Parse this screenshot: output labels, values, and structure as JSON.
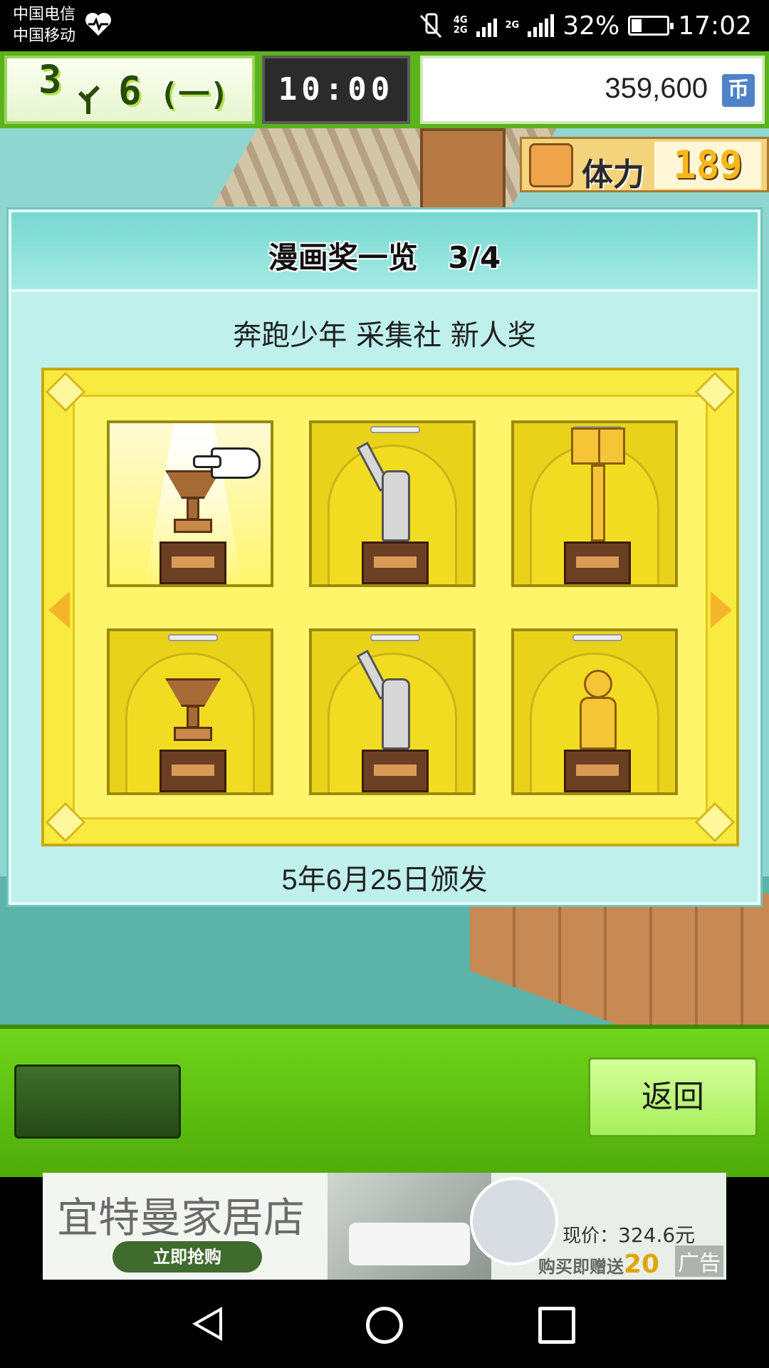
{
  "status_bar": {
    "carrier_1": "中国电信",
    "carrier_2": "中国移动",
    "net_1": "4G",
    "net_2": "2G",
    "net_3": "2G",
    "battery": "32%",
    "time": "17:02",
    "icons": [
      "heart-icon",
      "mute-icon",
      "signal-icon",
      "battery-icon"
    ]
  },
  "hud": {
    "year": "3",
    "month": "6",
    "week": "(一)",
    "time_display": "10:00",
    "money": "359,600",
    "currency_icon_label": "币"
  },
  "stats": {
    "stamina_label": "体力",
    "stamina_value": "189"
  },
  "modal": {
    "title": "漫画奖一览 3/4",
    "award_name": "奔跑少年 采集社 新人奖",
    "award_date": "5年6月25日颁发",
    "trophies": [
      {
        "name": "bronze-cup-trophy",
        "selected": true
      },
      {
        "name": "silver-figure-trophy"
      },
      {
        "name": "gold-book-trophy"
      },
      {
        "name": "bronze-cup-trophy"
      },
      {
        "name": "silver-figure-trophy"
      },
      {
        "name": "gold-statue-trophy"
      }
    ]
  },
  "bottom_bar": {
    "back_label": "返回"
  },
  "ad": {
    "brand": "宜特曼家居店",
    "cta": "立即抢购",
    "price_label": "现价：",
    "price_value": "324.6元",
    "promo": "购买即赠送",
    "promo_num": "20",
    "ad_tag": "广告"
  }
}
